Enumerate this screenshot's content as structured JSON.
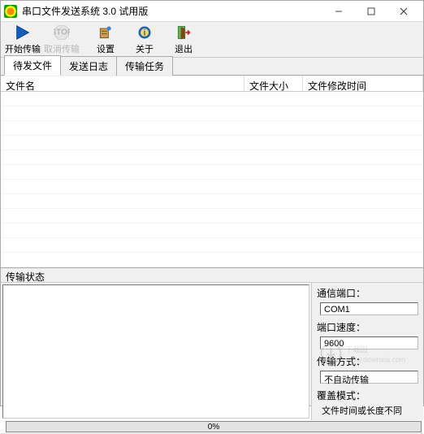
{
  "window": {
    "title": "串口文件发送系统 3.0 试用版"
  },
  "toolbar": {
    "start": "开始传输",
    "cancel": "取消传输",
    "settings": "设置",
    "about": "关于",
    "exit": "退出"
  },
  "tabs": {
    "pending": "待发文件",
    "log": "发送日志",
    "tasks": "传输任务"
  },
  "columns": {
    "filename": "文件名",
    "filesize": "文件大小",
    "filemtime": "文件修改时间"
  },
  "status": {
    "header": "传输状态",
    "com_port_label": "通信端口：",
    "com_port_value": "COM1",
    "baud_label": "端口速度：",
    "baud_value": "9600",
    "mode_label": "传输方式：",
    "mode_value": "不自动传输",
    "overwrite_label": "覆盖模式：",
    "overwrite_value": "文件时间或长度不同"
  },
  "progress": {
    "text": "0%"
  },
  "watermark": {
    "text": "下载园",
    "url": "www.downxia.com"
  }
}
